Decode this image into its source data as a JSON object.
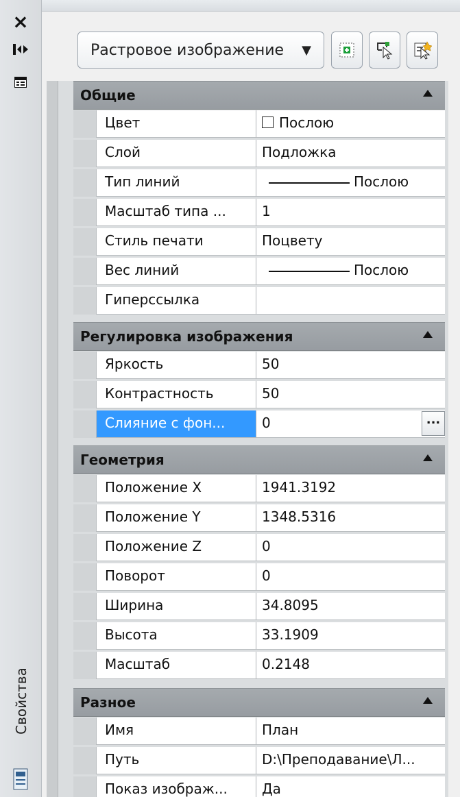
{
  "panel": {
    "title": "Свойства",
    "selected_object": "Растровое изображение"
  },
  "groups": {
    "general": {
      "title": "Общие",
      "rows": {
        "color": {
          "name": "Цвет",
          "value": "Послою"
        },
        "layer": {
          "name": "Слой",
          "value": "Подложка"
        },
        "linetype": {
          "name": "Тип линий",
          "value": "Послою"
        },
        "linetype_scale": {
          "name": "Масштаб типа ...",
          "value": "1"
        },
        "plot_style": {
          "name": "Стиль печати",
          "value": "Поцвету"
        },
        "lineweight": {
          "name": "Вес линий",
          "value": "Послою"
        },
        "hyperlink": {
          "name": "Гиперссылка",
          "value": ""
        }
      }
    },
    "image_adjust": {
      "title": "Регулировка изображения",
      "rows": {
        "brightness": {
          "name": "Яркость",
          "value": "50"
        },
        "contrast": {
          "name": "Контрастность",
          "value": "50"
        },
        "fade": {
          "name": "Слияние с фон...",
          "value": "0",
          "button": "..."
        }
      }
    },
    "geometry": {
      "title": "Геометрия",
      "rows": {
        "pos_x": {
          "name": "Положение X",
          "value": "1941.3192"
        },
        "pos_y": {
          "name": "Положение Y",
          "value": "1348.5316"
        },
        "pos_z": {
          "name": "Положение Z",
          "value": "0"
        },
        "rotation": {
          "name": "Поворот",
          "value": "0"
        },
        "width": {
          "name": "Ширина",
          "value": "34.8095"
        },
        "height": {
          "name": "Высота",
          "value": "33.1909"
        },
        "scale": {
          "name": "Масштаб",
          "value": "0.2148"
        }
      }
    },
    "misc": {
      "title": "Разное",
      "rows": {
        "name": {
          "name": "Имя",
          "value": "План"
        },
        "path": {
          "name": "Путь",
          "value": "D:\\Преподавание\\Л..."
        },
        "show_image": {
          "name": "Показ изображ...",
          "value": "Да"
        }
      }
    }
  },
  "colors": {
    "selection_blue": "#3399ff",
    "header_gray": "#9ea3a7"
  }
}
